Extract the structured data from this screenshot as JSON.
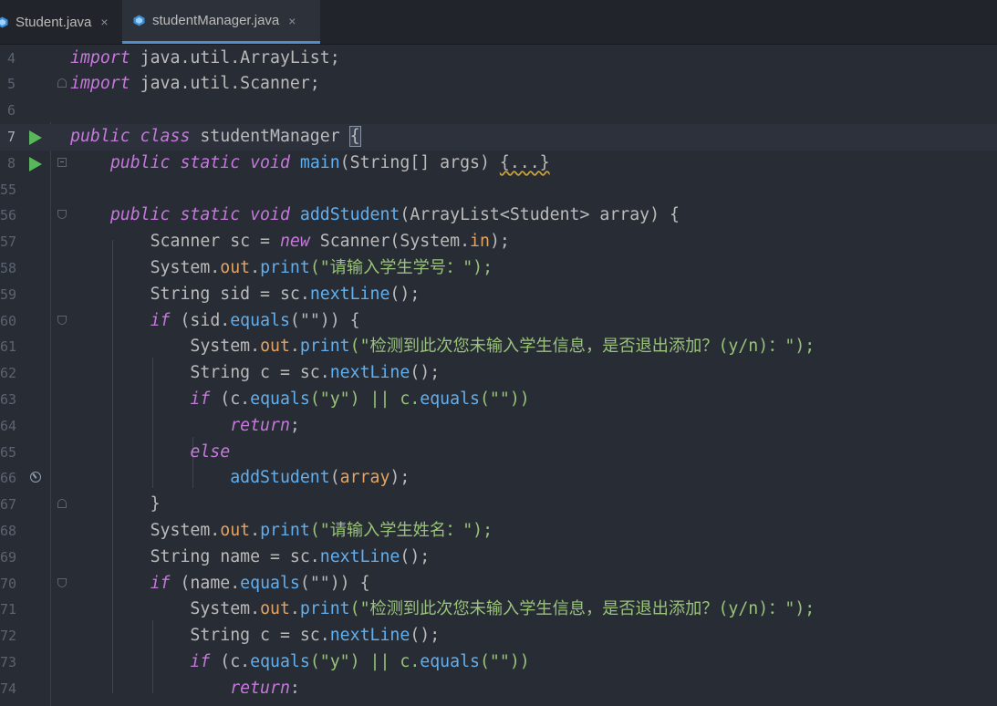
{
  "tabs": [
    {
      "label": "Student.java",
      "close": "×",
      "active": false
    },
    {
      "label": "studentManager.java",
      "close": "×",
      "active": true
    }
  ],
  "line_numbers": [
    "4",
    "5",
    "6",
    "7",
    "8",
    "55",
    "56",
    "57",
    "58",
    "59",
    "60",
    "61",
    "62",
    "63",
    "64",
    "65",
    "66",
    "67",
    "68",
    "69",
    "70",
    "71",
    "72",
    "73",
    "74"
  ],
  "code": {
    "import1_kw": "import",
    "import1_rest": " java.util.ArrayList;",
    "import2_kw": "import",
    "import2_rest": " java.util.Scanner;",
    "class_kw": "public class",
    "class_name": " studentManager ",
    "brace_open": "{",
    "main_kw": "public static void",
    "main_fn": " main",
    "main_args": "(String[] args) ",
    "main_folded": "{...}",
    "add_kw": "public static void",
    "add_fn": " addStudent",
    "add_args": "(ArrayList<Student> array) {",
    "sc_type": "Scanner sc = ",
    "sc_new": "new",
    "sc_rest": " Scanner(System.",
    "sc_in": "in",
    "sc_end": ");",
    "sys": "System.",
    "out": "out",
    "dot": ".",
    "print": "print",
    "prompt_sid": "(\"请输入学生学号：\");",
    "sid_decl": "String sid = sc.",
    "next_line": "nextLine",
    "call_end": "();",
    "if_kw": "if",
    "sid_if": " (sid.",
    "equals": "equals",
    "empty_cond_open": "(\"\")) {",
    "prompt_exit": "(\"检测到此次您未输入学生信息，是否退出添加？(y/n)：\");",
    "c_decl": "String c = sc.",
    "c_if": " (c.",
    "y_arg": "(\"y\") || c.",
    "empty_arg_close": "(\"\"))",
    "return_kw": "return",
    "semicolon": ";",
    "else_kw": "else",
    "add_call": "addStudent",
    "add_call_open": "(",
    "array_arg": "array",
    "add_call_close": ");",
    "close_brace": "}",
    "prompt_name": "(\"请输入学生姓名：\");",
    "name_decl": "String name = sc.",
    "name_if": " (name."
  }
}
